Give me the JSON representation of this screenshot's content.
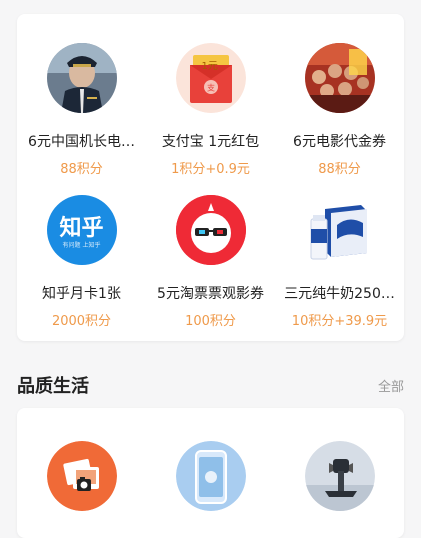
{
  "featured": {
    "items": [
      {
        "title": "6元中国机长电…",
        "price": "88积分",
        "icon": "movie-poster-captain"
      },
      {
        "title": "支付宝 1元红包",
        "price": "1积分+0.9元",
        "icon": "alipay-red-envelope",
        "badge": "1元"
      },
      {
        "title": "6元电影代金券",
        "price": "88积分",
        "icon": "movie-poster-motherland"
      },
      {
        "title": "知乎月卡1张",
        "price": "2000积分",
        "icon": "zhihu-logo",
        "logo_text": "知乎",
        "logo_sub": "有问题 上知乎"
      },
      {
        "title": "5元淘票票观影券",
        "price": "100积分",
        "icon": "taopiaopiao-logo"
      },
      {
        "title": "三元纯牛奶250…",
        "price": "10积分+39.9元",
        "icon": "milk-box"
      }
    ]
  },
  "quality": {
    "title": "品质生活",
    "more_label": "全部",
    "items": [
      {
        "icon": "photo-print-icon"
      },
      {
        "icon": "phone-screen-icon"
      },
      {
        "icon": "car-phone-holder-icon"
      }
    ]
  }
}
